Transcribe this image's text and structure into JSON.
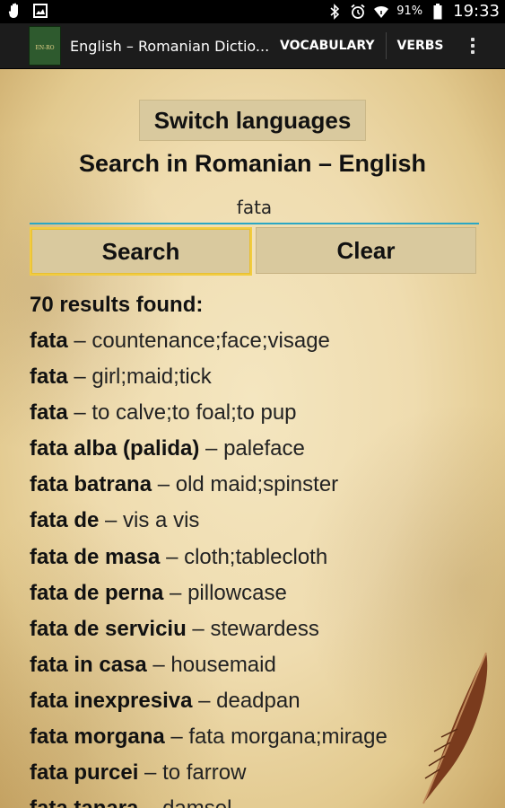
{
  "status_bar": {
    "battery_pct": "91%",
    "time": "19:33",
    "icons": [
      "hand-icon",
      "image-icon",
      "bluetooth-icon",
      "alarm-icon",
      "wifi-icon",
      "battery-icon"
    ]
  },
  "action_bar": {
    "app_icon_text": "EN-RO",
    "title": "English – Romanian Dictio...",
    "vocabulary_label": "VOCABULARY",
    "verbs_label": "VERBS"
  },
  "main": {
    "switch_languages_label": "Switch languages",
    "search_title": "Search in Romanian – English",
    "search_value": "fata",
    "search_button_label": "Search",
    "clear_button_label": "Clear",
    "results_count_text": "70 results found:",
    "results": [
      {
        "term": "fata",
        "def": "countenance;face;visage"
      },
      {
        "term": "fata",
        "def": "girl;maid;tick"
      },
      {
        "term": "fata",
        "def": "to calve;to foal;to pup"
      },
      {
        "term": "fata alba (palida)",
        "def": "paleface"
      },
      {
        "term": "fata batrana",
        "def": "old maid;spinster"
      },
      {
        "term": "fata de",
        "def": "vis a vis"
      },
      {
        "term": "fata de masa",
        "def": "cloth;tablecloth"
      },
      {
        "term": "fata de perna",
        "def": "pillowcase"
      },
      {
        "term": "fata de serviciu",
        "def": "stewardess"
      },
      {
        "term": "fata in casa",
        "def": "housemaid"
      },
      {
        "term": "fata inexpresiva",
        "def": "deadpan"
      },
      {
        "term": "fata morgana",
        "def": "fata morgana;mirage"
      },
      {
        "term": "fata purcei",
        "def": "to farrow"
      },
      {
        "term": "fata tanara",
        "def": "damsel"
      }
    ],
    "separator": " – "
  },
  "colors": {
    "accent": "#2aa7c4",
    "focus_border": "#f2cc3f",
    "button_bg": "#d9c99e",
    "action_bar_bg": "#1c1c1c"
  }
}
